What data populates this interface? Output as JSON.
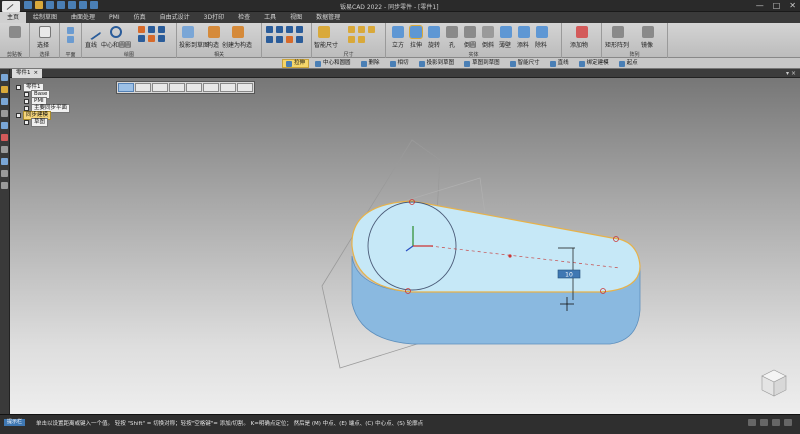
{
  "app": {
    "title": "钣易CAD 2022 - 同步零件 - [零件1]"
  },
  "ribbon_tabs": [
    "主页",
    "绘制草图",
    "曲面处理",
    "PMI",
    "仿真",
    "自由式设计",
    "3D打印",
    "检查",
    "工具",
    "视图",
    "数据管理"
  ],
  "active_tab_index": 0,
  "ribbon": {
    "groups": [
      {
        "label": "剪贴板"
      },
      {
        "label": "选择"
      },
      {
        "label": "平面"
      },
      {
        "label": "绘图"
      },
      {
        "label": "相关"
      },
      {
        "label": "尺寸"
      },
      {
        "label": "实体"
      },
      {
        "label": "阵列"
      }
    ],
    "buttons": {
      "select": "选择",
      "line": "直线",
      "circle_center": "中心和圆圆",
      "project": "投影到草图",
      "pattern": "构造",
      "create_pattern": "创建为构造",
      "smart_dim": "智能尺寸",
      "extrude": "立方",
      "pull": "拉伸",
      "rotate": "旋转",
      "hole": "孔",
      "round": "倒圆",
      "chamfer": "倒斜",
      "thin": "薄壁",
      "thicken": "添料",
      "remove": "除料",
      "add": "添加物",
      "rect_pattern": "矩形阵列",
      "mirror": "镜像"
    }
  },
  "command_bar": {
    "items": [
      "拉伸",
      "中心和圆圆",
      "删除",
      "相切",
      "投影到草图",
      "草图到草图",
      "智能尺寸",
      "直线",
      "绑定建模",
      "起点"
    ],
    "selected_index": 0
  },
  "document_tab": {
    "label": "零件1",
    "close_symbol": "×"
  },
  "tree": {
    "items": [
      {
        "label": "零件1",
        "level": 0
      },
      {
        "label": "Base",
        "level": 1
      },
      {
        "label": "PMI",
        "level": 1
      },
      {
        "label": "主要同步平面",
        "level": 1
      },
      {
        "label": "同步建模",
        "level": 0,
        "highlighted": true
      },
      {
        "label": "草图",
        "level": 1
      }
    ]
  },
  "dimension_label": "10",
  "status_bar": {
    "mode": "提示栏",
    "message": "单击以设置距离或键入一个值。 轻按 \"Shift\" = 切换对称；轻按\"空格键\"= 添加/切割。 K=明确点定位； 然后是 (M) 中点、(E) 端点、(C) 中心点、(S) 轮廓点"
  },
  "colors": {
    "accent": "#3f78b3",
    "highlight": "#f6d66a",
    "part_top": "#bfe3f5",
    "part_side": "#8ab9e0",
    "edge": "#e7b24a"
  }
}
